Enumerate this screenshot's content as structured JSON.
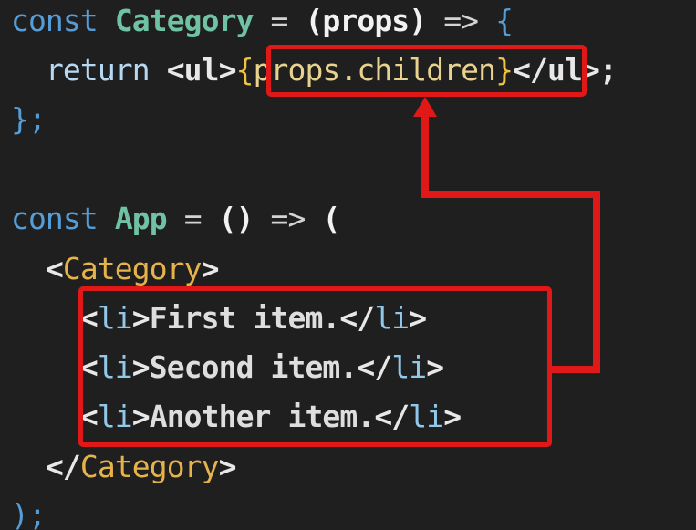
{
  "code": {
    "line1": {
      "kw": "const",
      "name": "Category",
      "eq": "=",
      "params": "(props)",
      "arrow": "=>",
      "brace": "{"
    },
    "line2": {
      "ret": "return",
      "open_tag": "<ul>",
      "expr_open": "{",
      "expr": "props.children",
      "expr_close": "}",
      "close_tag": "</ul>;"
    },
    "line3": {
      "end": "};"
    },
    "line5": {
      "kw": "const",
      "name": "App",
      "eq": "=",
      "params": "()",
      "arrow": "=>",
      "paren": "("
    },
    "line6": {
      "lt": "<",
      "comp": "Category",
      "gt": ">"
    },
    "items": [
      {
        "open_lt": "<",
        "open_tag": "li",
        "open_gt": ">",
        "text": "First item.",
        "close_lt": "</",
        "close_tag": "li",
        "close_gt": ">"
      },
      {
        "open_lt": "<",
        "open_tag": "li",
        "open_gt": ">",
        "text": "Second item.",
        "close_lt": "</",
        "close_tag": "li",
        "close_gt": ">"
      },
      {
        "open_lt": "<",
        "open_tag": "li",
        "open_gt": ">",
        "text": "Another item.",
        "close_lt": "</",
        "close_tag": "li",
        "close_gt": ">"
      }
    ],
    "line10": {
      "lt": "</",
      "comp": "Category",
      "gt": ">"
    },
    "line11": {
      "end": ");"
    }
  },
  "annotation": {
    "color": "#e01818"
  }
}
